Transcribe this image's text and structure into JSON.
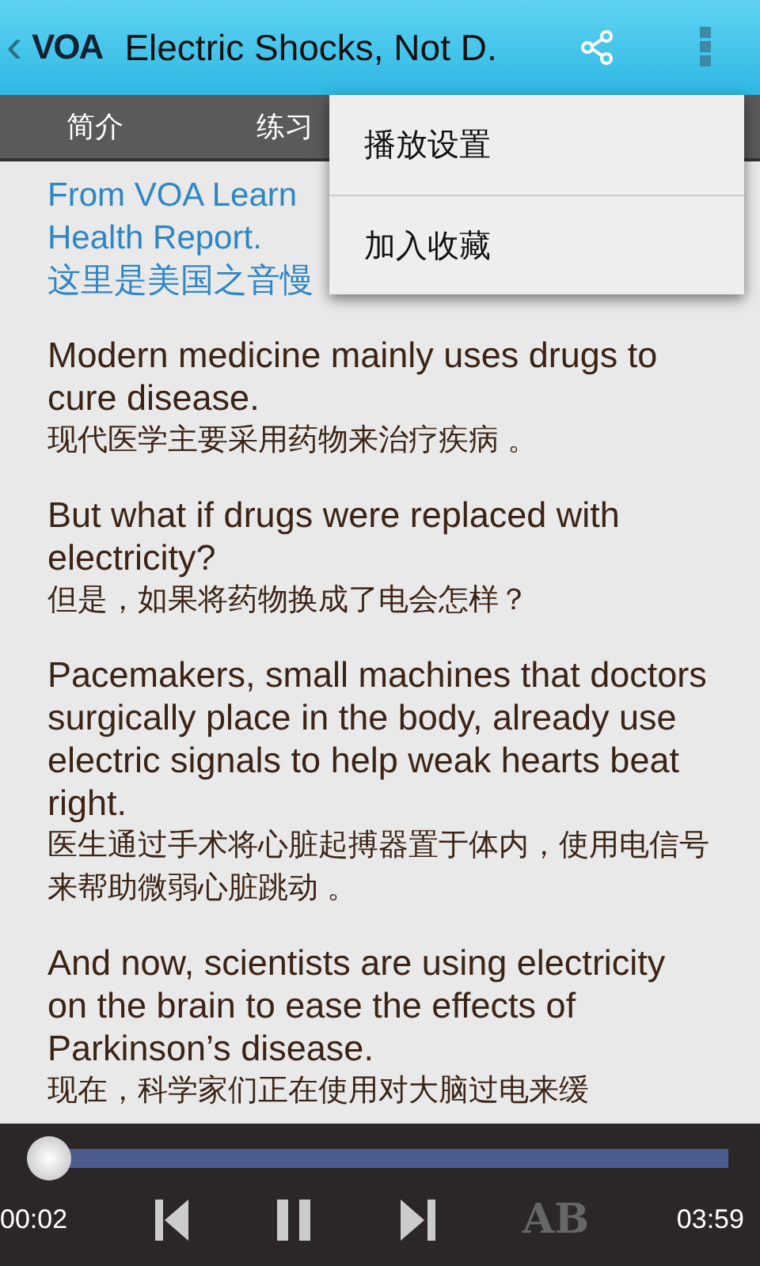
{
  "header": {
    "back": "‹",
    "logo": "VOA",
    "title": "Electric Shocks, Not D."
  },
  "tabs": [
    {
      "label": "简介"
    },
    {
      "label": "练习"
    }
  ],
  "menu": {
    "items": [
      {
        "label": "播放设置"
      },
      {
        "label": "加入收藏"
      }
    ]
  },
  "intro": [
    "From VOA Learn",
    "Health Report.",
    "这里是美国之音慢"
  ],
  "paragraphs": [
    {
      "en": "Modern medicine mainly uses drugs to cure disease.",
      "zh": "现代医学主要采用药物来治疗疾病 。"
    },
    {
      "en": "But what if drugs were replaced with electricity?",
      "zh": "但是，如果将药物换成了电会怎样？"
    },
    {
      "en": "Pacemakers, small machines that doctors surgically place in the body, already use electric signals to help weak hearts beat right.",
      "zh": "医生通过手术将心脏起搏器置于体内，使用电信号来帮助微弱心脏跳动 。"
    },
    {
      "en": "And now, scientists are using electricity on the brain to ease the effects of Parkinson’s disease.",
      "zh": "现在，科学家们正在使用对大脑过电来缓"
    }
  ],
  "player": {
    "level": 0.02,
    "elapsed": "00:02",
    "total": "03:59",
    "ab": "AB"
  }
}
